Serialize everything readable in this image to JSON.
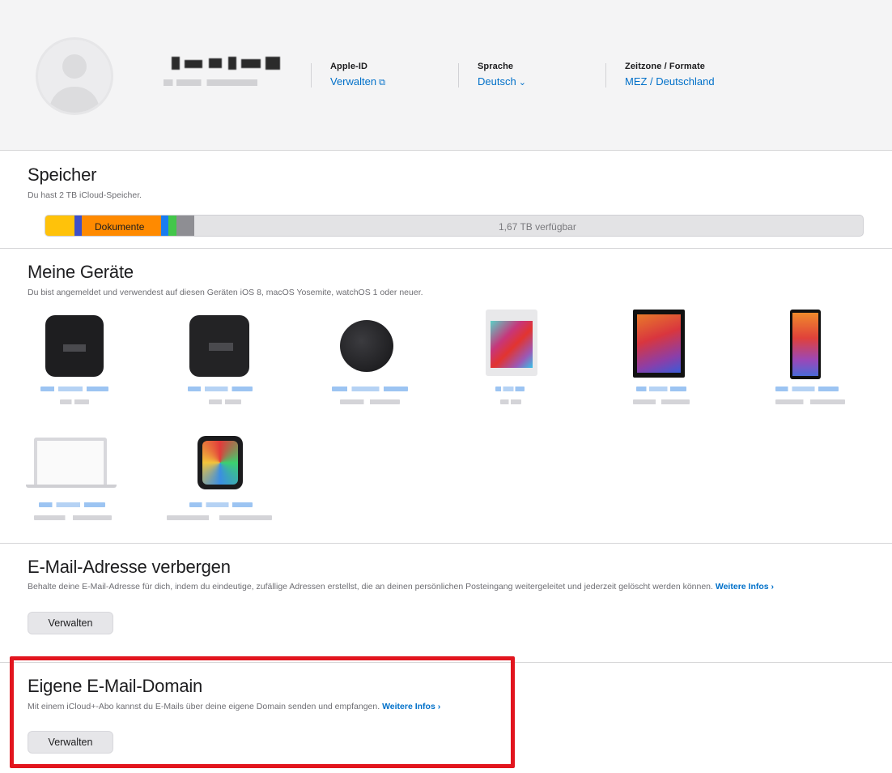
{
  "header": {
    "apple_id": {
      "label": "Apple-ID",
      "value": "Verwalten"
    },
    "language": {
      "label": "Sprache",
      "value": "Deutsch"
    },
    "timezone": {
      "label": "Zeitzone / Formate",
      "value": "MEZ / Deutschland"
    }
  },
  "storage": {
    "title": "Speicher",
    "description": "Du hast 2 TB iCloud-Speicher.",
    "segment_label": "Dokumente",
    "available_label": "1,67 TB verfügbar",
    "colors": {
      "yellow": "#ffc20a",
      "blue": "#3e50c9",
      "orange": "#ff8a00",
      "lightblue": "#1a7cf0",
      "green": "#43c64a",
      "gray": "#8e8e93"
    }
  },
  "devices": {
    "title": "Meine Geräte",
    "description": "Du bist angemeldet und verwendest auf diesen Geräten iOS 8, macOS Yosemite, watchOS 1 oder neuer."
  },
  "hide_email": {
    "title": "E-Mail-Adresse verbergen",
    "description": "Behalte deine E-Mail-Adresse für dich, indem du eindeutige, zufällige Adressen erstellst, die an deinen persönlichen Posteingang weitergeleitet und jederzeit gelöscht werden können.",
    "link": "Weitere Infos ›",
    "button": "Verwalten"
  },
  "custom_domain": {
    "title": "Eigene E-Mail-Domain",
    "description": "Mit einem iCloud+-Abo kannst du E-Mails über deine eigene Domain senden und empfangen.",
    "link": "Weitere Infos ›",
    "button": "Verwalten"
  },
  "icons": {
    "external_link": "⧉",
    "chevron_down": "⌄"
  }
}
